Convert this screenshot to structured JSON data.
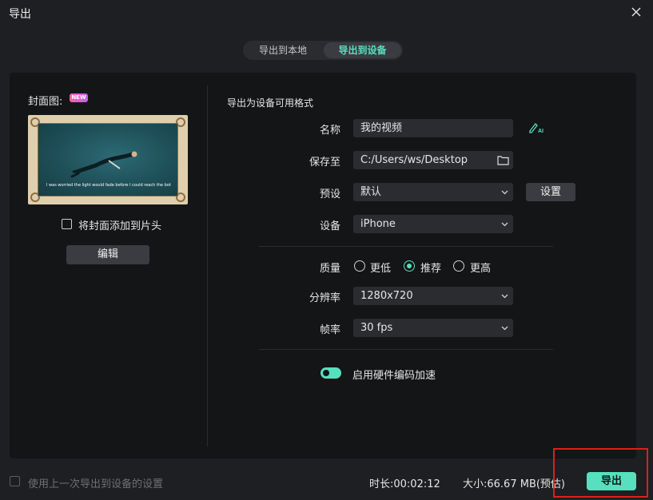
{
  "window": {
    "title": "导出"
  },
  "tabs": [
    {
      "label": "导出到本地",
      "active": false
    },
    {
      "label": "导出到设备",
      "active": true
    }
  ],
  "cover": {
    "label": "封面图:",
    "badge": "NEW",
    "caption": "I was worried the light would fade before I could reach the bottom",
    "add_to_start_label": "将封面添加到片头",
    "add_to_start_checked": false,
    "edit_button": "编辑"
  },
  "settings": {
    "section_title": "导出为设备可用格式",
    "name": {
      "label": "名称",
      "value": "我的视频"
    },
    "save_to": {
      "label": "保存至",
      "value": "C:/Users/ws/Desktop"
    },
    "preset": {
      "label": "预设",
      "value": "默认",
      "settings_button": "设置"
    },
    "device": {
      "label": "设备",
      "value": "iPhone"
    },
    "quality": {
      "label": "质量",
      "options": [
        {
          "label": "更低",
          "selected": false
        },
        {
          "label": "推荐",
          "selected": true
        },
        {
          "label": "更高",
          "selected": false
        }
      ]
    },
    "resolution": {
      "label": "分辨率",
      "value": "1280x720"
    },
    "frame_rate": {
      "label": "帧率",
      "value": "30 fps"
    },
    "hardware_accel": {
      "label": "启用硬件编码加速",
      "enabled": true
    }
  },
  "footer": {
    "use_last_settings_label": "使用上一次导出到设备的设置",
    "use_last_settings_checked": false,
    "duration": "时长:00:02:12",
    "size": "大小:66.67 MB(预估)",
    "export_button": "导出"
  },
  "colors": {
    "background": "#1e1f22",
    "panel": "#141517",
    "field": "#2b2c30",
    "accent": "#57e0bd",
    "highlight": "#e11d1d"
  },
  "icons": [
    "close-icon",
    "ai-pen-icon",
    "folder-icon",
    "chevron-down-icon"
  ]
}
